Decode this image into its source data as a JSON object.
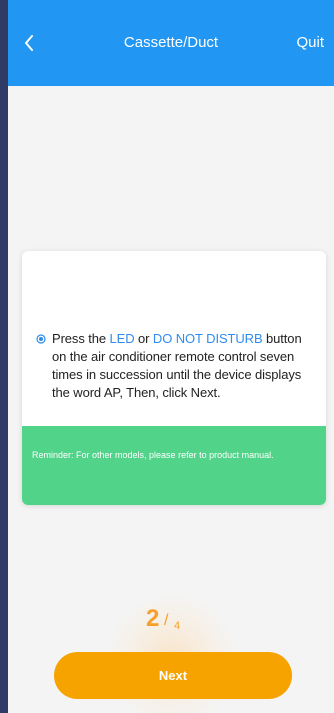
{
  "header": {
    "back_icon": "chevron-left-icon",
    "title": "Cassette/Duct",
    "quit_label": "Quit",
    "background_color": "#2196f3"
  },
  "card": {
    "bullet_icon": "radio-dot-icon",
    "instruction": {
      "prefix": "Press the ",
      "led": "LED",
      "or_text": " or ",
      "dnd": "DO NOT DISTURB",
      "suffix": " button on the air conditioner remote control seven times in succession until the device displays the word AP, Then, click Next."
    },
    "reminder": "Reminder: For other models, please refer to product manual."
  },
  "progress": {
    "current": "2",
    "slash": "/",
    "total": "4"
  },
  "footer": {
    "next_label": "Next"
  },
  "colors": {
    "accent": "#2f8cf0",
    "reminder_bg": "#52d38a",
    "primary_button": "#f6a300",
    "step_text": "#f6a02b"
  }
}
